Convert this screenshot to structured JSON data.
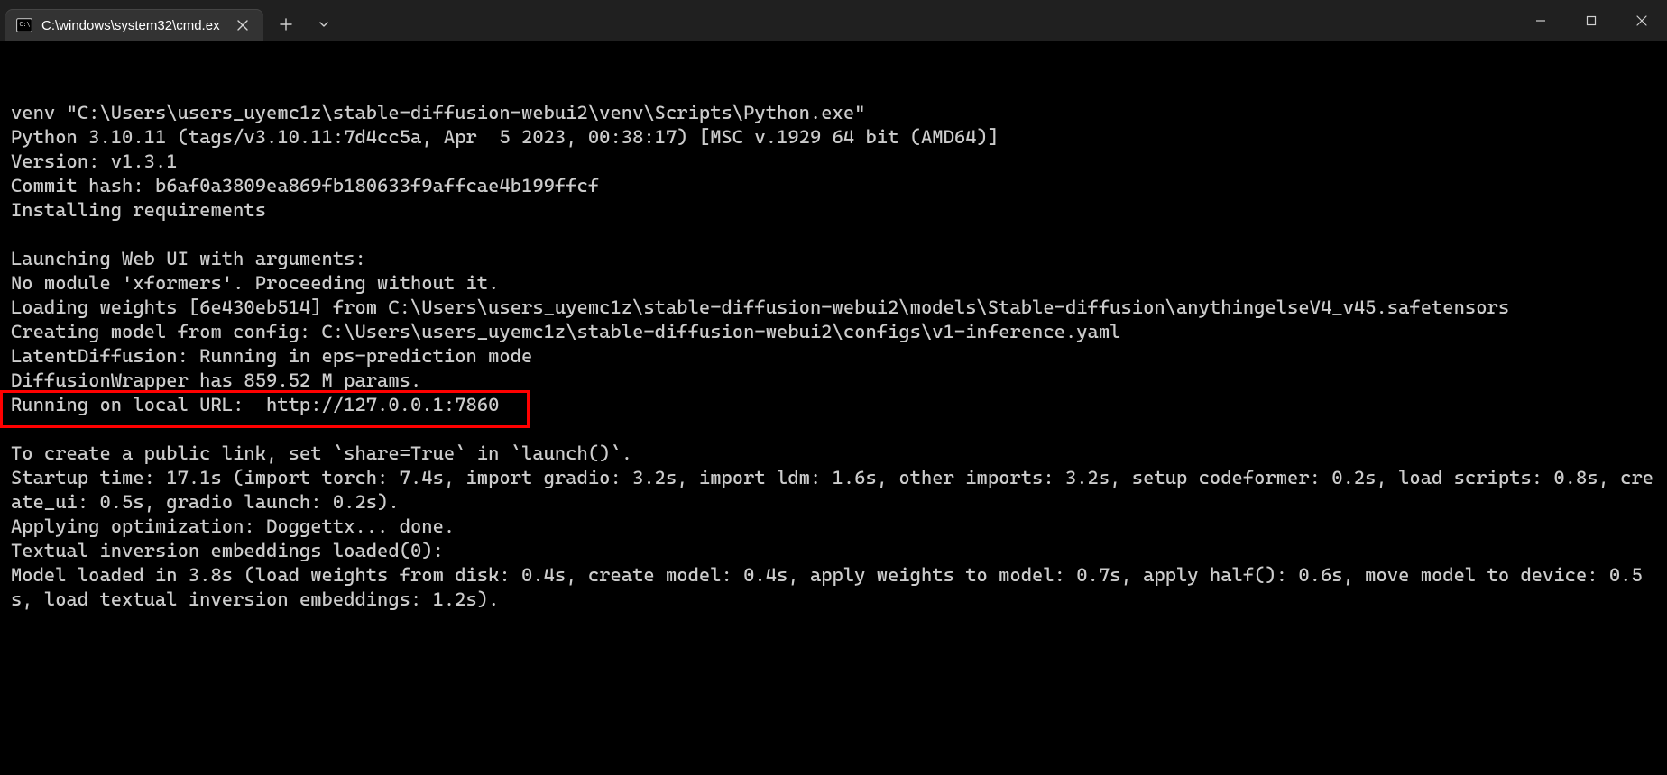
{
  "window": {
    "tab_title": "C:\\windows\\system32\\cmd.ex"
  },
  "terminal": {
    "lines": [
      "venv \"C:\\Users\\users_uyemc1z\\stable-diffusion-webui2\\venv\\Scripts\\Python.exe\"",
      "Python 3.10.11 (tags/v3.10.11:7d4cc5a, Apr  5 2023, 00:38:17) [MSC v.1929 64 bit (AMD64)]",
      "Version: v1.3.1",
      "Commit hash: b6af0a3809ea869fb180633f9affcae4b199ffcf",
      "Installing requirements",
      "",
      "Launching Web UI with arguments:",
      "No module 'xformers'. Proceeding without it.",
      "Loading weights [6e430eb514] from C:\\Users\\users_uyemc1z\\stable-diffusion-webui2\\models\\Stable-diffusion\\anythingelseV4_v45.safetensors",
      "Creating model from config: C:\\Users\\users_uyemc1z\\stable-diffusion-webui2\\configs\\v1-inference.yaml",
      "LatentDiffusion: Running in eps-prediction mode",
      "DiffusionWrapper has 859.52 M params.",
      "Running on local URL:  http://127.0.0.1:7860",
      "",
      "To create a public link, set `share=True` in `launch()`.",
      "Startup time: 17.1s (import torch: 7.4s, import gradio: 3.2s, import ldm: 1.6s, other imports: 3.2s, setup codeformer: 0.2s, load scripts: 0.8s, create_ui: 0.5s, gradio launch: 0.2s).",
      "Applying optimization: Doggettx... done.",
      "Textual inversion embeddings loaded(0):",
      "Model loaded in 3.8s (load weights from disk: 0.4s, create model: 0.4s, apply weights to model: 0.7s, apply half(): 0.6s, move model to device: 0.5s, load textual inversion embeddings: 1.2s)."
    ],
    "highlighted_line_text": "Running on local URL:  http://127.0.0.1:7860"
  }
}
